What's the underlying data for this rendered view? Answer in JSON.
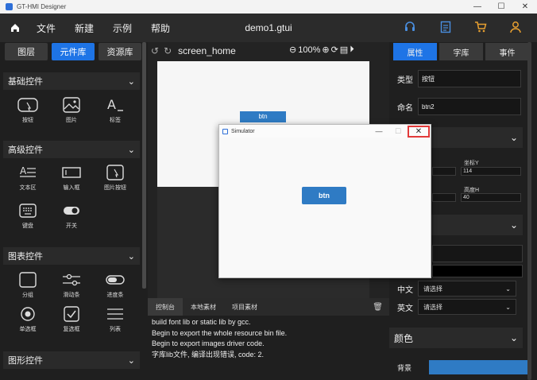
{
  "window": {
    "title": "GT-HMI Designer",
    "min": "—",
    "max": "☐",
    "close": "✕"
  },
  "menu": {
    "items": [
      "文件",
      "新建",
      "示例",
      "帮助"
    ],
    "doc_title": "demo1.gtui"
  },
  "left": {
    "tabs": [
      "图层",
      "元件库",
      "资源库"
    ],
    "active_tab": 1,
    "sections": [
      {
        "title": "基础控件",
        "widgets": [
          {
            "label": "按钮",
            "icon": "button-icon"
          },
          {
            "label": "图片",
            "icon": "image-icon"
          },
          {
            "label": "标签",
            "icon": "label-icon"
          }
        ]
      },
      {
        "title": "高级控件",
        "widgets": [
          {
            "label": "文本区",
            "icon": "textarea-icon"
          },
          {
            "label": "输入框",
            "icon": "input-icon"
          },
          {
            "label": "图片按钮",
            "icon": "image-button-icon"
          },
          {
            "label": "键盘",
            "icon": "keyboard-icon"
          },
          {
            "label": "开关",
            "icon": "switch-icon"
          }
        ]
      },
      {
        "title": "图表控件",
        "widgets": [
          {
            "label": "分组",
            "icon": "group-icon"
          },
          {
            "label": "滑动条",
            "icon": "slider-icon"
          },
          {
            "label": "进度条",
            "icon": "progress-icon"
          },
          {
            "label": "单选框",
            "icon": "radio-icon"
          },
          {
            "label": "复选框",
            "icon": "checkbox-icon"
          },
          {
            "label": "列表",
            "icon": "list-icon"
          }
        ]
      },
      {
        "title": "图形控件",
        "widgets": []
      }
    ]
  },
  "center": {
    "screen_name": "screen_home",
    "zoom": "100%",
    "canvas_button": "btn",
    "console_tabs": [
      "控制台",
      "本地素材",
      "项目素材"
    ],
    "console_lines": [
      "build font lib or static lib by gcc.",
      "Begin to export the whole resource bin file.",
      "Begin to export images driver code.",
      "字库lib文件, 编译出现错误, code: 2."
    ]
  },
  "right": {
    "tabs": [
      "属性",
      "字库",
      "事件"
    ],
    "active_tab": 0,
    "type_label": "类型",
    "type_value": "按钮",
    "name_label": "命名",
    "name_value": "btn2",
    "coord_y_label": "坐标Y",
    "coord_y_value": "114",
    "height_label": "高度H",
    "height_value": "40",
    "chinese_label": "中文",
    "english_label": "英文",
    "select_placeholder": "请选择",
    "color_section": "颜色",
    "bg_label": "背景",
    "bg_color": "#2f7bc4"
  },
  "simulator": {
    "title": "Simulator",
    "button": "btn"
  }
}
